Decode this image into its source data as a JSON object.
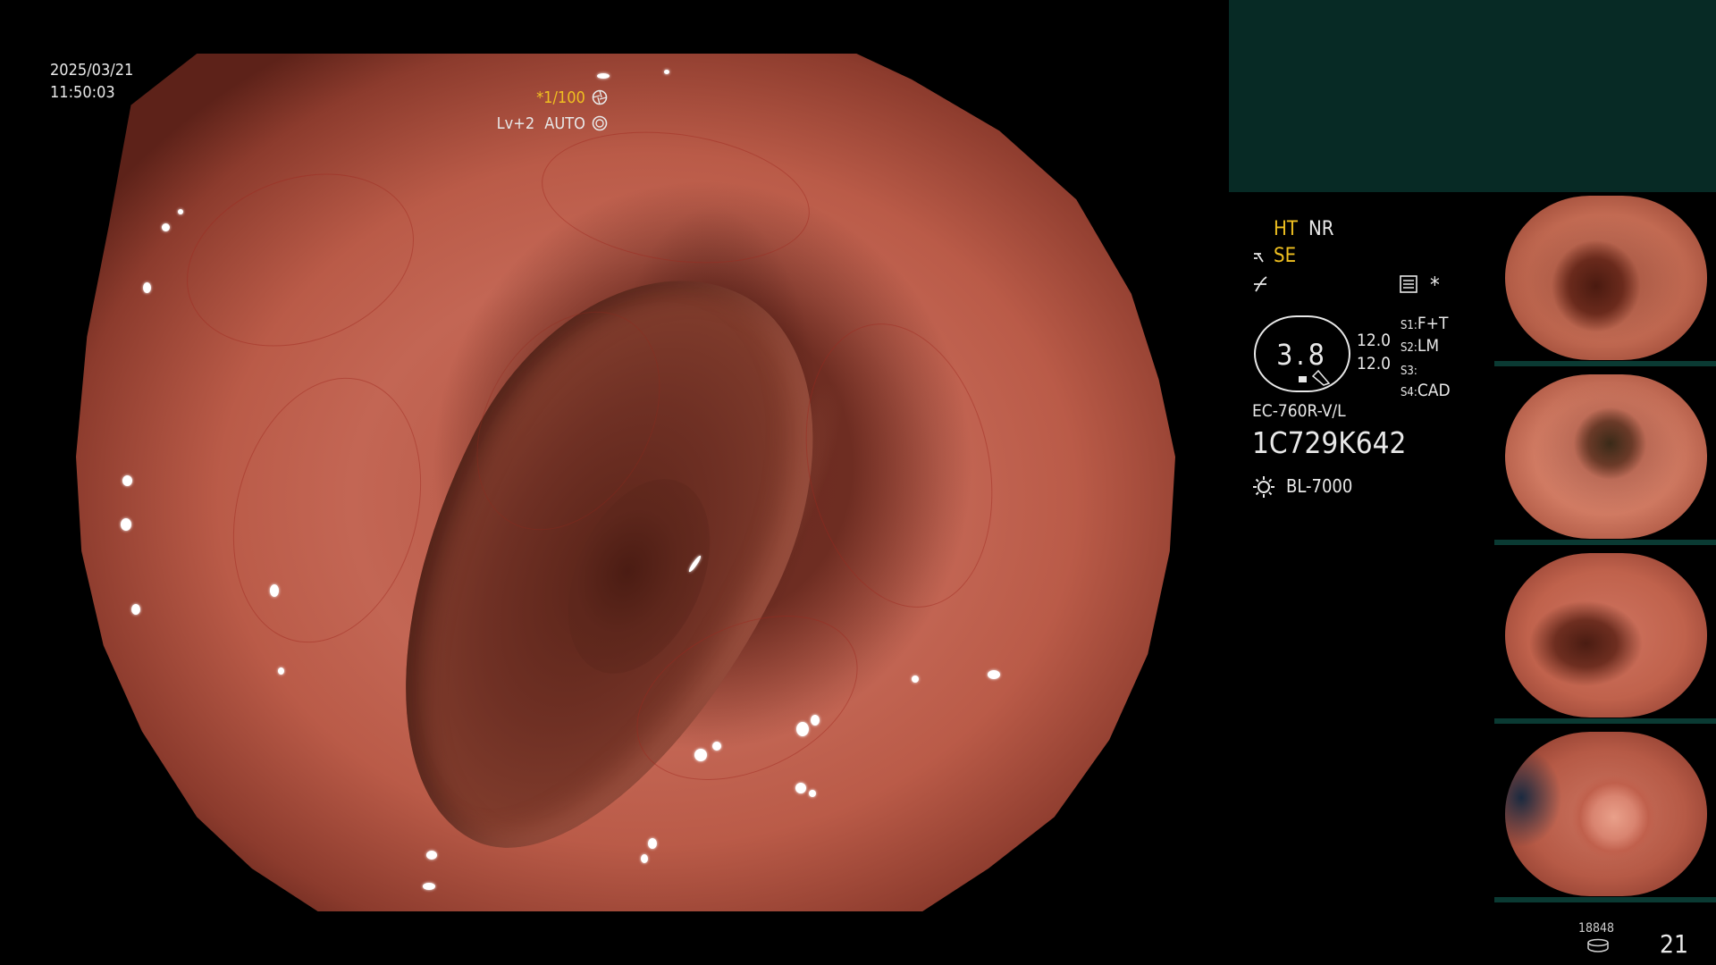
{
  "osd": {
    "date": "2025/03/21",
    "time": "11:50:03",
    "exposure": "*1/100",
    "level": "Lv+2",
    "iris_mode": "AUTO"
  },
  "settings": {
    "ht": "HT",
    "nr": "NR",
    "se": "SE",
    "gauge_value": "3.8",
    "dial_top": "12.0",
    "dial_bottom": "12.0",
    "s1_label": "S1",
    "s1_value": "F+T",
    "s2_label": "S2",
    "s2_value": "LM",
    "s3_label": "S3",
    "s3_value": "",
    "s4_label": "S4",
    "s4_value": "CAD",
    "scope_model": "EC-760R-V/L",
    "serial": "1C729K642",
    "light_source": "BL-7000",
    "asterisk": "*"
  },
  "footer": {
    "storage_count": "18848",
    "capture_count": "21"
  },
  "colors": {
    "osd_text": "#e8e8e8",
    "highlight_yellow": "#f0c020",
    "panel_dark_teal": "#072a25",
    "mucosa": "#c36654"
  }
}
